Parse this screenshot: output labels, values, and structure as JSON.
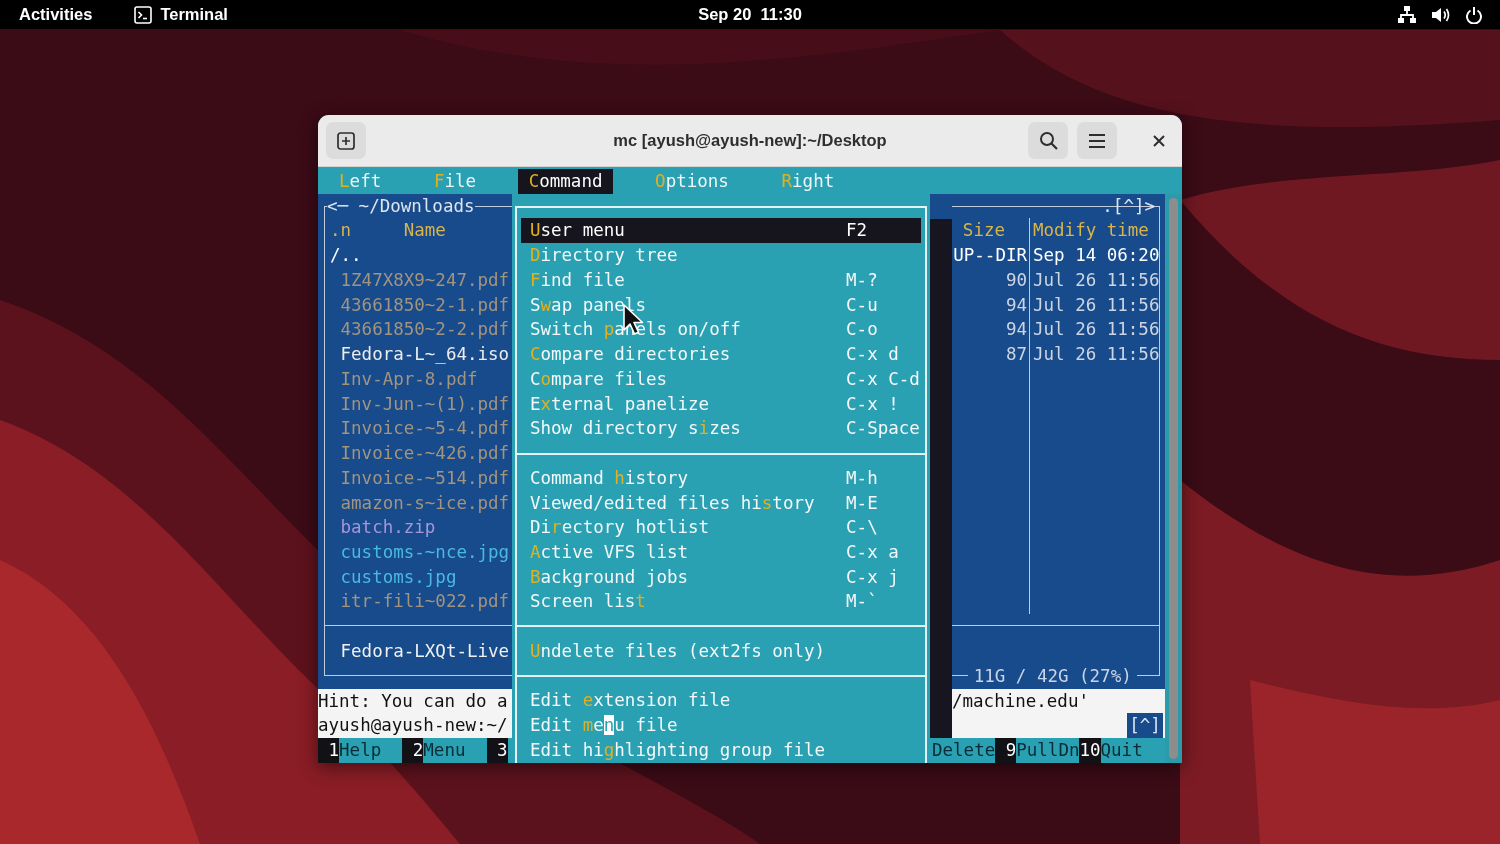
{
  "top_bar": {
    "activities": "Activities",
    "app": "Terminal",
    "clock": "Sep 20  11:30"
  },
  "window": {
    "title": "mc [ayush@ayush-new]:~/Desktop"
  },
  "menu_bar": [
    {
      "parts": [
        {
          "text": "L",
          "hotkey": true
        },
        {
          "text": "eft",
          "hotkey": false
        }
      ],
      "selected": false
    },
    {
      "parts": [
        {
          "text": "F",
          "hotkey": true
        },
        {
          "text": "ile",
          "hotkey": false
        }
      ],
      "selected": false
    },
    {
      "parts": [
        {
          "text": "C",
          "hotkey": true
        },
        {
          "text": "ommand",
          "hotkey": false
        }
      ],
      "selected": true
    },
    {
      "parts": [
        {
          "text": "O",
          "hotkey": true
        },
        {
          "text": "ptions",
          "hotkey": false
        }
      ],
      "selected": false
    },
    {
      "parts": [
        {
          "text": "R",
          "hotkey": true
        },
        {
          "text": "ight",
          "hotkey": false
        }
      ],
      "selected": false
    }
  ],
  "left_panel": {
    "title": "<─ ~/Downloads",
    "columns": [
      ".n",
      "Name"
    ],
    "rows": [
      {
        "name": "/..",
        "kind": "updir"
      },
      {
        "name": "1Z47X8X9~247.pdf",
        "kind": "pdf"
      },
      {
        "name": "43661850~2-1.pdf",
        "kind": "pdf"
      },
      {
        "name": "43661850~2-2.pdf",
        "kind": "pdf"
      },
      {
        "name": "Fedora-L~_64.iso",
        "kind": "iso"
      },
      {
        "name": "Inv-Apr-8.pdf",
        "kind": "pdf"
      },
      {
        "name": "Inv-Jun-~(1).pdf",
        "kind": "pdf"
      },
      {
        "name": "Invoice-~5-4.pdf",
        "kind": "pdf"
      },
      {
        "name": "Invoice-~426.pdf",
        "kind": "pdf"
      },
      {
        "name": "Invoice-~514.pdf",
        "kind": "pdf"
      },
      {
        "name": "amazon-s~ice.pdf",
        "kind": "pdf"
      },
      {
        "name": "batch.zip",
        "kind": "zip"
      },
      {
        "name": "customs-~nce.jpg",
        "kind": "jpg"
      },
      {
        "name": "customs.jpg",
        "kind": "jpg"
      },
      {
        "name": "itr-fili~022.pdf",
        "kind": "pdf"
      }
    ],
    "mini_status": "Fedora-LXQt-Live"
  },
  "command_menu": {
    "groups": [
      {
        "items": [
          {
            "parts": [
              {
                "text": "U",
                "hotkey": true
              },
              {
                "text": "ser menu",
                "hotkey": false
              }
            ],
            "shortcut": "F2",
            "selected": true
          },
          {
            "parts": [
              {
                "text": "D",
                "hotkey": true
              },
              {
                "text": "irectory tree",
                "hotkey": false
              }
            ],
            "selected": false
          },
          {
            "parts": [
              {
                "text": "F",
                "hotkey": true
              },
              {
                "text": "ind file",
                "hotkey": false
              }
            ],
            "shortcut": "M-?",
            "selected": false
          },
          {
            "parts": [
              {
                "text": "S",
                "hotkey": false
              },
              {
                "text": "w",
                "hotkey": true
              },
              {
                "text": "ap panels",
                "hotkey": false
              }
            ],
            "shortcut": "C-u",
            "selected": false
          },
          {
            "parts": [
              {
                "text": "Switch ",
                "hotkey": false
              },
              {
                "text": "p",
                "hotkey": true
              },
              {
                "text": "anels on/off",
                "hotkey": false
              }
            ],
            "shortcut": "C-o",
            "selected": false
          },
          {
            "parts": [
              {
                "text": "C",
                "hotkey": true
              },
              {
                "text": "ompare directories",
                "hotkey": false
              }
            ],
            "shortcut": "C-x d",
            "selected": false
          },
          {
            "parts": [
              {
                "text": "C",
                "hotkey": false
              },
              {
                "text": "o",
                "hotkey": true
              },
              {
                "text": "mpare files",
                "hotkey": false
              }
            ],
            "shortcut": "C-x C-d",
            "selected": false
          },
          {
            "parts": [
              {
                "text": "E",
                "hotkey": false
              },
              {
                "text": "x",
                "hotkey": true
              },
              {
                "text": "ternal panelize",
                "hotkey": false
              }
            ],
            "shortcut": "C-x !",
            "selected": false
          },
          {
            "parts": [
              {
                "text": "Show directory s",
                "hotkey": false
              },
              {
                "text": "i",
                "hotkey": true
              },
              {
                "text": "zes",
                "hotkey": false
              }
            ],
            "shortcut": "C-Space",
            "selected": false
          }
        ]
      },
      {
        "items": [
          {
            "parts": [
              {
                "text": "Command ",
                "hotkey": false
              },
              {
                "text": "h",
                "hotkey": true
              },
              {
                "text": "istory",
                "hotkey": false
              }
            ],
            "shortcut": "M-h",
            "selected": false
          },
          {
            "parts": [
              {
                "text": "Viewed/edited files hi",
                "hotkey": false
              },
              {
                "text": "s",
                "hotkey": true
              },
              {
                "text": "tory",
                "hotkey": false
              }
            ],
            "shortcut": "M-E",
            "selected": false
          },
          {
            "parts": [
              {
                "text": "Di",
                "hotkey": false
              },
              {
                "text": "r",
                "hotkey": true
              },
              {
                "text": "ectory hotlist",
                "hotkey": false
              }
            ],
            "shortcut": "C-\\",
            "selected": false
          },
          {
            "parts": [
              {
                "text": "A",
                "hotkey": true
              },
              {
                "text": "ctive VFS list",
                "hotkey": false
              }
            ],
            "shortcut": "C-x a",
            "selected": false
          },
          {
            "parts": [
              {
                "text": "B",
                "hotkey": true
              },
              {
                "text": "ackground jobs",
                "hotkey": false
              }
            ],
            "shortcut": "C-x j",
            "selected": false
          },
          {
            "parts": [
              {
                "text": "Screen lis",
                "hotkey": false
              },
              {
                "text": "t",
                "hotkey": true
              }
            ],
            "shortcut": "M-`",
            "selected": false
          }
        ]
      },
      {
        "items": [
          {
            "parts": [
              {
                "text": "U",
                "hotkey": true
              },
              {
                "text": "ndelete files (ext2fs only)",
                "hotkey": false
              }
            ],
            "selected": false
          }
        ]
      },
      {
        "items": [
          {
            "parts": [
              {
                "text": "Edit ",
                "hotkey": false
              },
              {
                "text": "e",
                "hotkey": true
              },
              {
                "text": "xtension file",
                "hotkey": false
              }
            ],
            "selected": false
          },
          {
            "parts": [
              {
                "text": "Edit ",
                "hotkey": false,
                "cursor": false
              },
              {
                "text": "m",
                "hotkey": true,
                "cursor": false
              },
              {
                "text": "e",
                "hotkey": false,
                "cursor": false
              },
              {
                "text": "n",
                "hotkey": false,
                "cursor": true
              },
              {
                "text": "u file",
                "hotkey": false,
                "cursor": false
              }
            ],
            "selected": false
          },
          {
            "parts": [
              {
                "text": "Edit hi",
                "hotkey": false
              },
              {
                "text": "g",
                "hotkey": true
              },
              {
                "text": "hlighting group file",
                "hotkey": false
              }
            ],
            "selected": false
          }
        ]
      }
    ]
  },
  "right_panel": {
    "title": ".[^]>",
    "columns": [
      "Size",
      "Modify time"
    ],
    "rows": [
      {
        "size": "UP--DIR",
        "time": "Sep 14 06:20",
        "kind": "updir"
      },
      {
        "size": "90",
        "time": "Jul 26 11:56",
        "kind": "file"
      },
      {
        "size": "94",
        "time": "Jul 26 11:56",
        "kind": "file"
      },
      {
        "size": "94",
        "time": "Jul 26 11:56",
        "kind": "file"
      },
      {
        "size": "87",
        "time": "Jul 26 11:56",
        "kind": "file"
      }
    ],
    "disk_usage": "11G / 42G (27%)"
  },
  "hint": {
    "left": "Hint: You can do a",
    "right": "/machine.edu'"
  },
  "prompt": {
    "text": "ayush@ayush-new:~/",
    "history_button": "[^]"
  },
  "function_keys_left": [
    {
      "number": "1",
      "label": "Help"
    },
    {
      "number": "2",
      "label": "Menu"
    },
    {
      "number": "3"
    }
  ],
  "function_keys_right": [
    {
      "label": "Delete"
    },
    {
      "number": "9",
      "label": "PullDn"
    },
    {
      "number": "10",
      "label": "Quit"
    }
  ]
}
